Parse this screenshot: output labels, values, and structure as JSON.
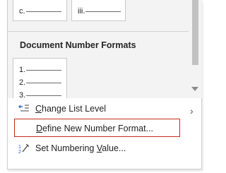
{
  "gallery": {
    "top_thumbs": [
      {
        "marker": "c."
      },
      {
        "marker": "iii."
      }
    ],
    "section_title": "Document Number Formats",
    "document_thumb": {
      "markers": [
        "1.",
        "2.",
        "3."
      ]
    }
  },
  "menu": {
    "change_list_level": {
      "pre": "",
      "accel": "C",
      "post": "hange List Level",
      "icon": "list-indent-icon",
      "has_submenu": true
    },
    "define_new_number_format": {
      "pre": "",
      "accel": "D",
      "post": "efine New Number Format...",
      "highlighted": true
    },
    "set_numbering_value": {
      "pre": "Set Numbering ",
      "accel": "V",
      "post": "alue...",
      "icon": "numbering-value-icon"
    }
  },
  "colors": {
    "highlight_border": "#c42b1c",
    "icon_blue": "#2b62c9"
  }
}
